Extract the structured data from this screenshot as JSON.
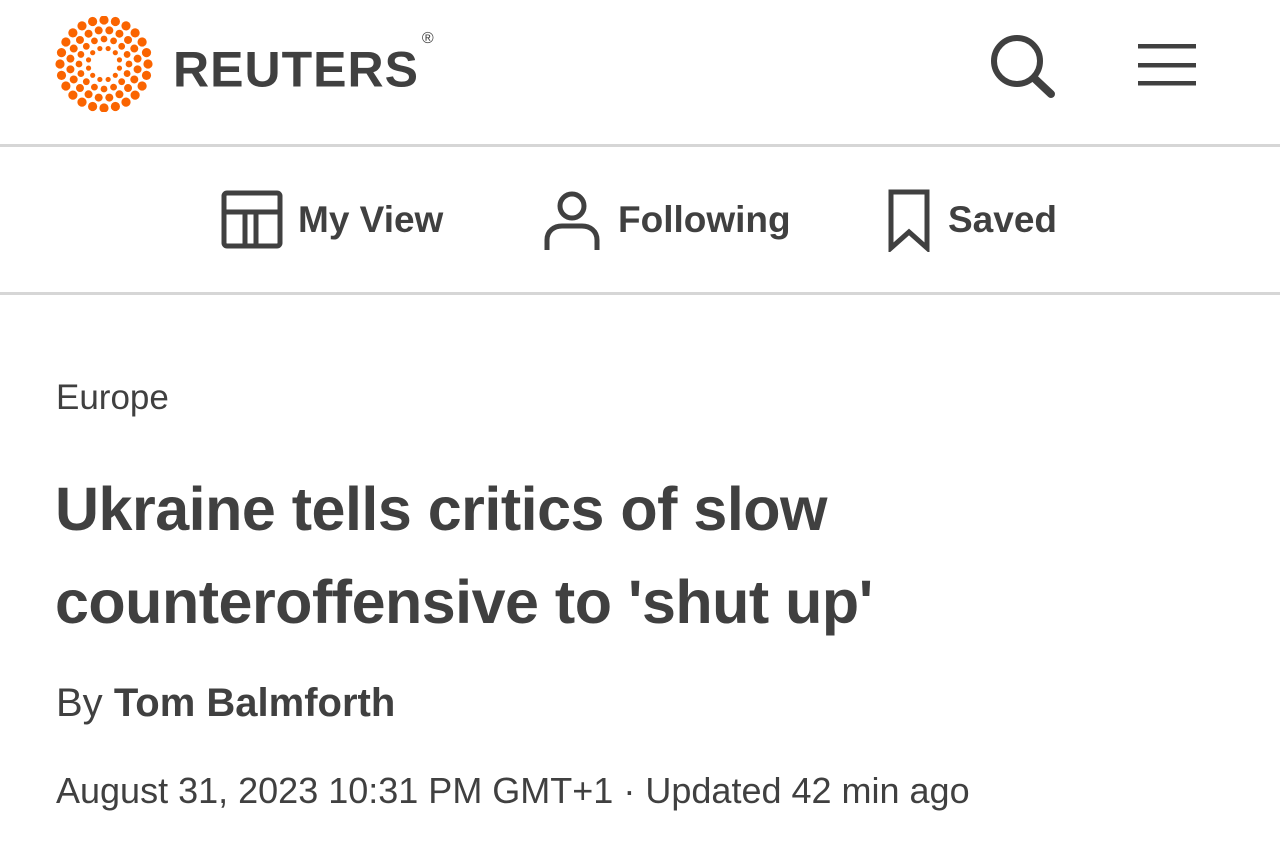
{
  "header": {
    "brand": "REUTERS",
    "registered_mark": "®",
    "logo_icon": "reuters-dot-logo-icon",
    "search_icon": "search-icon",
    "menu_icon": "hamburger-menu-icon",
    "brand_color": "#fa6400"
  },
  "subnav": {
    "items": [
      {
        "label": "My View",
        "icon": "layout-icon"
      },
      {
        "label": "Following",
        "icon": "person-icon"
      },
      {
        "label": "Saved",
        "icon": "bookmark-icon"
      }
    ]
  },
  "article": {
    "section": "Europe",
    "headline": "Ukraine tells critics of slow counteroffensive to 'shut up'",
    "byline_prefix": "By",
    "author": "Tom Balmforth",
    "date": "August 31, 2023 10:31 PM GMT+1",
    "separator": "·",
    "updated": "Updated 42 min ago"
  }
}
